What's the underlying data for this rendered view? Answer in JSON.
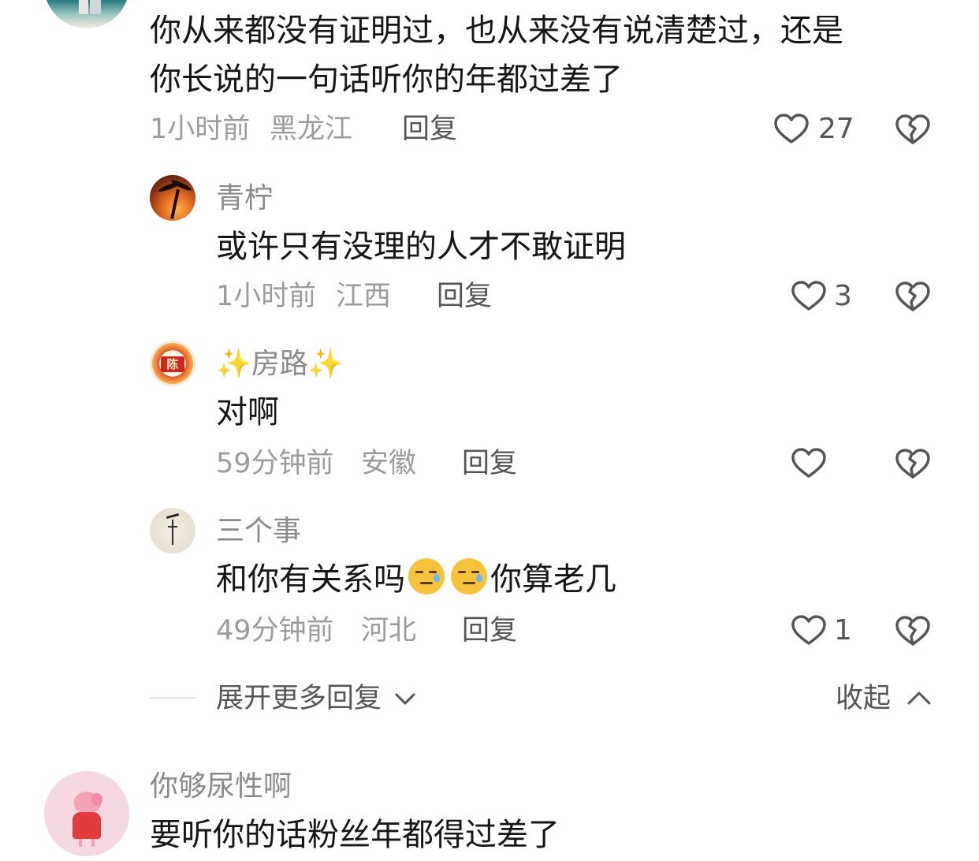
{
  "comments": {
    "top": {
      "text_line1": "你从来都没有证明过，也从来没有说清楚过，还是",
      "text_line2": "你长说的一句话听你的年都过差了",
      "time": "1小时前",
      "location": "黑龙江",
      "reply_label": "回复",
      "like_count": "27"
    },
    "replies": [
      {
        "username": "青柠",
        "text": "或许只有没理的人才不敢证明",
        "time": "1小时前",
        "location": "江西",
        "reply_label": "回复",
        "like_count": "3"
      },
      {
        "username_sparkle_left": "✨",
        "username": "房路",
        "username_sparkle_right": "✨",
        "avatar_seal_text": "陈",
        "text": "对啊",
        "time": "59分钟前",
        "location": "安徽",
        "reply_label": "回复",
        "like_count": ""
      },
      {
        "username": "三个事",
        "text_part1": "和你有关系吗",
        "text_part2": "你算老几",
        "time": "49分钟前",
        "location": "河北",
        "reply_label": "回复",
        "like_count": "1"
      }
    ],
    "expand_label": "展开更多回复",
    "collapse_label": "收起",
    "next": {
      "username": "你够尿性啊",
      "text": "要听你的话粉丝年都得过差了"
    }
  },
  "icons": {
    "like": "heart-outline-icon",
    "dislike": "broken-heart-icon",
    "expand": "chevron-down-icon",
    "collapse": "chevron-up-icon"
  },
  "colors": {
    "text": "#161616",
    "meta": "#9c9c9c",
    "secondary": "#555555",
    "sparkle": "#f5c518"
  }
}
